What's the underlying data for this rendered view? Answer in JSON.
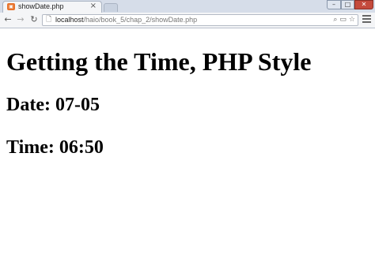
{
  "browser": {
    "tab": {
      "title": "showDate.php",
      "favicon": "php-page-icon"
    },
    "address": {
      "host": "localhost",
      "path": "/haio/book_5/chap_2/showDate.php"
    }
  },
  "page": {
    "heading": "Getting the Time, PHP Style",
    "date_line": "Date: 07-05",
    "time_line": "Time: 06:50"
  }
}
